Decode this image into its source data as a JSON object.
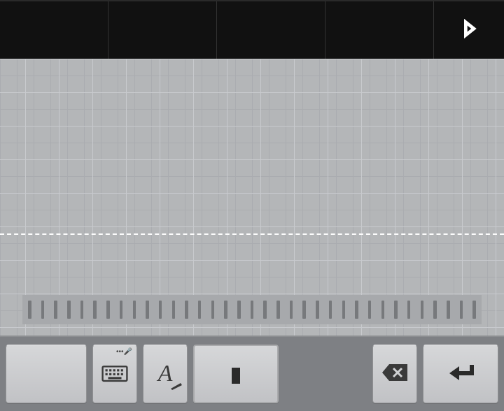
{
  "topbar": {
    "candidates": [
      "",
      "",
      "",
      ""
    ],
    "next_label": "next"
  },
  "handwrite": {
    "baseline_label": "baseline",
    "ruler_ticks": 35
  },
  "bottombar": {
    "switch_label": "",
    "keyboard_label": "keyboard",
    "style_label": "A",
    "space_label": "space",
    "backspace_label": "backspace",
    "enter_label": "enter"
  },
  "icons": {
    "chevron_right": "chevron-right-icon",
    "keyboard": "keyboard-icon",
    "mic": "mic-icon",
    "text_style": "text-style-icon",
    "space": "space-icon",
    "backspace": "backspace-icon",
    "enter": "enter-icon"
  }
}
